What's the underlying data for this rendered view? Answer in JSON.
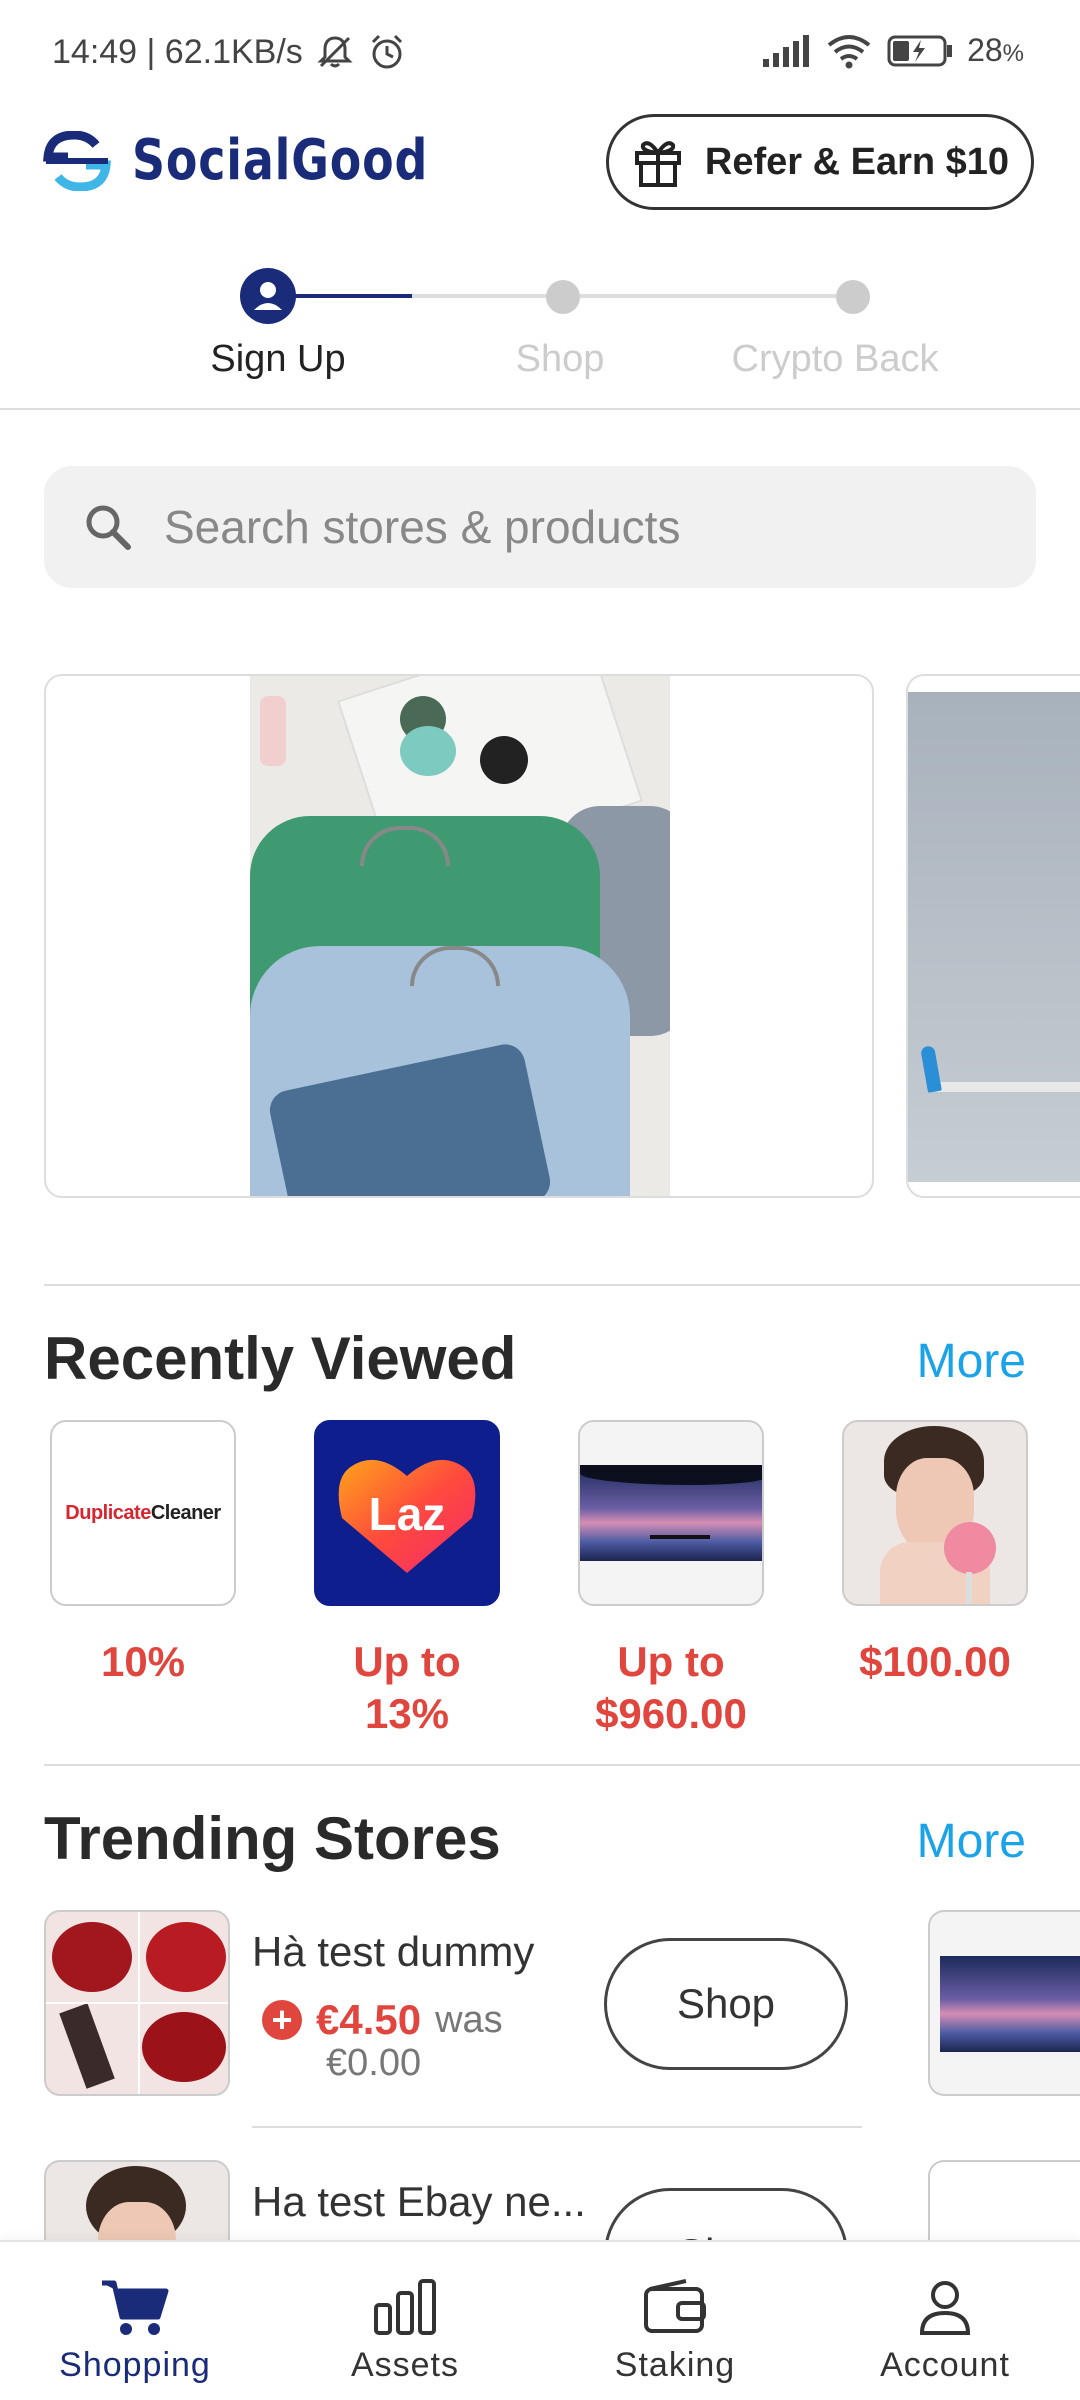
{
  "status_bar": {
    "time_speed": "14:49 | 62.1KB/s",
    "battery": "28",
    "battery_unit": "%"
  },
  "header": {
    "brand": "SocialGood",
    "refer_label": "Refer & Earn $10"
  },
  "stepper": {
    "steps": [
      {
        "label": "Sign Up",
        "active": true
      },
      {
        "label": "Shop",
        "active": false
      },
      {
        "label": "Crypto Back",
        "active": false
      }
    ]
  },
  "search": {
    "placeholder": "Search stores & products"
  },
  "recently_viewed": {
    "title": "Recently Viewed",
    "more": "More",
    "items": [
      {
        "logo": "DuplicateCleaner",
        "value": "10%"
      },
      {
        "logo": "Laz",
        "value": "Up to 13%"
      },
      {
        "logo": "",
        "value": "Up to $960.00"
      },
      {
        "logo": "",
        "value": "$100.00"
      }
    ]
  },
  "trending_stores": {
    "title": "Trending Stores",
    "more": "More",
    "rows": [
      {
        "name": "Hà test dummy",
        "plus": "+",
        "price": "€4.50",
        "was": "was",
        "old_price": "€0.00",
        "shop": "Shop"
      },
      {
        "name": "Ha test Ebay ne...",
        "shop": "Shop"
      }
    ]
  },
  "bottom_nav": {
    "items": [
      {
        "label": "Shopping",
        "icon": "cart-icon",
        "active": true
      },
      {
        "label": "Assets",
        "icon": "bar-chart-icon",
        "active": false
      },
      {
        "label": "Staking",
        "icon": "wallet-icon",
        "active": false
      },
      {
        "label": "Account",
        "icon": "person-icon",
        "active": false
      }
    ]
  },
  "colors": {
    "brand_navy": "#1a2b7a",
    "accent_red": "#e0453e",
    "link_blue": "#1aa3e8",
    "inactive_gray": "#cccccc"
  }
}
